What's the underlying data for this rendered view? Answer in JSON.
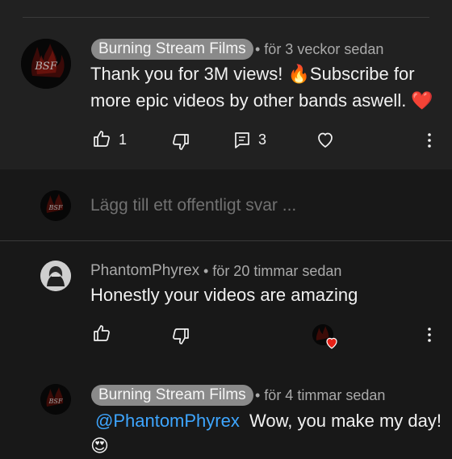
{
  "comment_pinned": {
    "author": "Burning Stream Films",
    "time": "• för 3 veckor sedan",
    "text_line1": "Thank you for 3M views! 🔥Subscribe for",
    "text_line2": "more epic videos by other bands aswell. ❤️",
    "likes": "1",
    "replies": "3"
  },
  "reply_input": {
    "placeholder": "Lägg till ett offentligt svar ..."
  },
  "comment_reply1": {
    "author": "PhantomPhyrex",
    "time": "• för 20 timmar sedan",
    "text": "Honestly your videos are amazing"
  },
  "comment_reply2": {
    "author": "Burning Stream Films",
    "time": "• för 4 timmar sedan",
    "mention": "@PhantomPhyrex",
    "text": "Wow, you make my day!",
    "emoji": "😍"
  },
  "colors": {
    "background": "#181818",
    "pinned_background": "#212121",
    "mention": "#3ea6ff",
    "heart": "#e62117"
  },
  "icons": [
    "thumb-up-icon",
    "thumb-down-icon",
    "reply-icon",
    "heart-icon",
    "more-vert-icon"
  ]
}
